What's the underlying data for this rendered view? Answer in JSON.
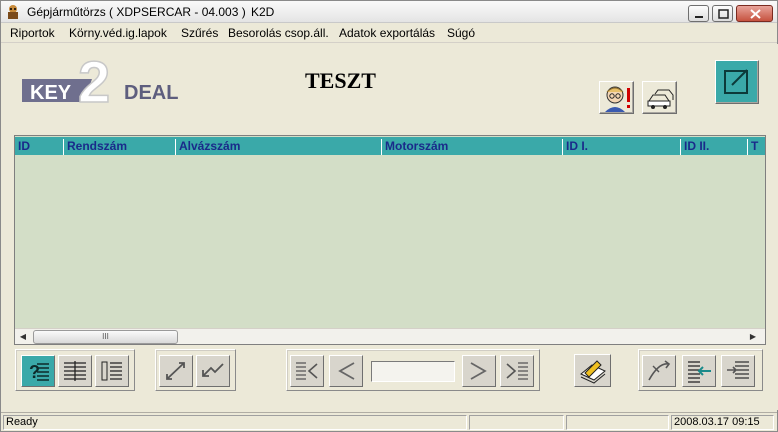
{
  "window": {
    "title": "Gépjárműtörzs ( XDPSERCAR - 04.003 )",
    "subtitle": "K2D"
  },
  "menu": [
    "Riportok",
    "Körny.véd.ig.lapok",
    "Szűrés",
    "Besorolás csop.áll.",
    "Adatok exportálás",
    "Súgó"
  ],
  "logo": {
    "left": "KEY",
    "digit": "2",
    "right": "DEAL"
  },
  "report_title": "TESZT",
  "grid": {
    "columns": [
      "ID",
      "Rendszám",
      "Alvázszám",
      "Motorszám",
      "ID I.",
      "ID II.",
      "T"
    ],
    "rows": []
  },
  "scrollbar": {
    "thumb_glyph": "III"
  },
  "status": {
    "message": "Ready",
    "datetime": "2008.03.17 09:15"
  },
  "colors": {
    "header_bg": "#3aa9a9",
    "header_text": "#1a2a8a",
    "grid_bg": "#d3dec7",
    "chrome": "#ece9d8"
  }
}
